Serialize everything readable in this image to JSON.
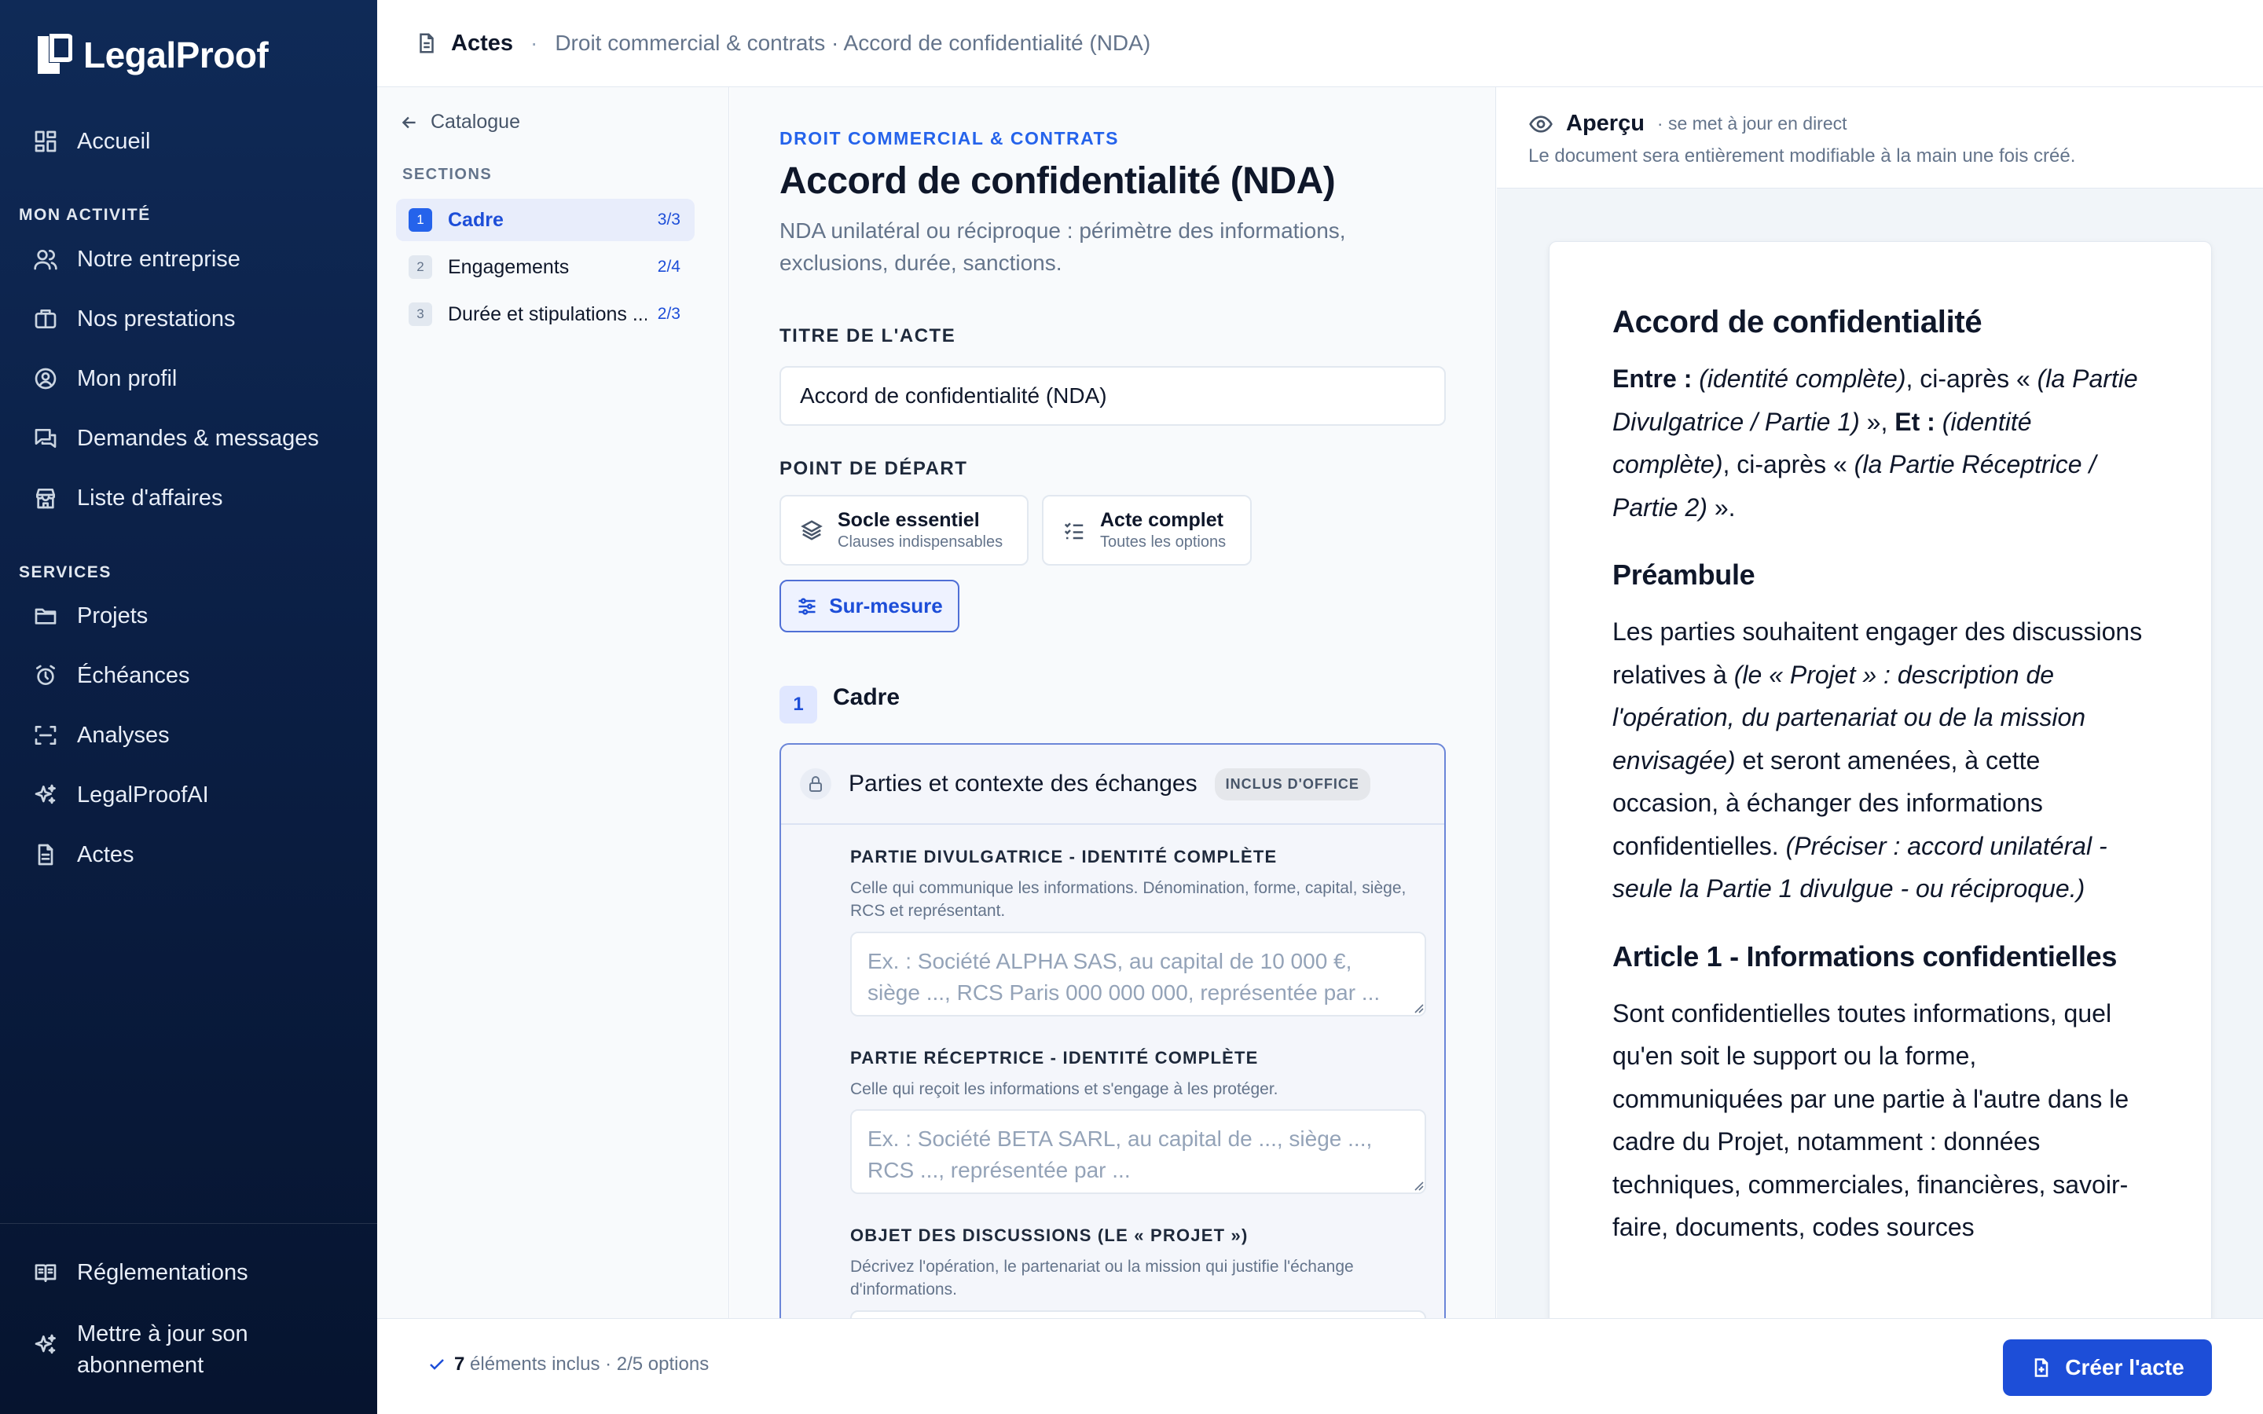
{
  "app": {
    "name": "LegalProof"
  },
  "sidebar": {
    "home": "Accueil",
    "activity_title": "MON ACTIVITÉ",
    "activity_items": [
      "Notre entreprise",
      "Nos prestations",
      "Mon profil",
      "Demandes & messages",
      "Liste d'affaires"
    ],
    "services_title": "SERVICES",
    "services_items": [
      "Projets",
      "Échéances",
      "Analyses",
      "LegalProofAI",
      "Actes"
    ],
    "bottom_items": [
      "Réglementations"
    ],
    "upgrade_line1": "Mettre à jour son",
    "upgrade_line2": "abonnement"
  },
  "breadcrumb": {
    "main": "Actes",
    "sep": "·",
    "rest": "Droit commercial & contrats · Accord de confidentialité (NDA)"
  },
  "sections_panel": {
    "back": "Catalogue",
    "title": "SECTIONS",
    "items": [
      {
        "num": "1",
        "label": "Cadre",
        "count": "3/3"
      },
      {
        "num": "2",
        "label": "Engagements",
        "count": "2/4"
      },
      {
        "num": "3",
        "label": "Durée et stipulations ...",
        "count": "2/3"
      }
    ]
  },
  "form": {
    "category": "DROIT COMMERCIAL & CONTRATS",
    "title": "Accord de confidentialité (NDA)",
    "subtitle": "NDA unilatéral ou réciproque : périmètre des informations, exclusions, durée, sanctions.",
    "title_label": "TITRE DE L'ACTE",
    "title_value": "Accord de confidentialité (NDA)",
    "start_label": "POINT DE DÉPART",
    "start_options": [
      {
        "title": "Socle essentiel",
        "sub": "Clauses indispensables"
      },
      {
        "title": "Acte complet",
        "sub": "Toutes les options"
      }
    ],
    "custom_label": "Sur-mesure",
    "step_num": "1",
    "step_title": "Cadre",
    "clause": {
      "title": "Parties et contexte des échanges",
      "badge": "INCLUS D'OFFICE",
      "fields": [
        {
          "label": "PARTIE DIVULGATRICE - IDENTITÉ COMPLÈTE",
          "help": "Celle qui communique les informations. Dénomination, forme, capital, siège, RCS et représentant.",
          "placeholder": "Ex. : Société ALPHA SAS, au capital de 10 000 €, siège ..., RCS Paris 000 000 000, représentée par ..."
        },
        {
          "label": "PARTIE RÉCEPTRICE - IDENTITÉ COMPLÈTE",
          "help": "Celle qui reçoit les informations et s'engage à les protéger.",
          "placeholder": "Ex. : Société BETA SARL, au capital de ..., siège ..., RCS ..., représentée par ..."
        },
        {
          "label": "OBJET DES DISCUSSIONS (LE « PROJET »)",
          "help": "Décrivez l'opération, le partenariat ou la mission qui justifie l'échange d'informations.",
          "placeholder": ""
        }
      ]
    }
  },
  "preview": {
    "title": "Aperçu",
    "live": "· se met à jour en direct",
    "note": "Le document sera entièrement modifiable à la main une fois créé.",
    "doc": {
      "h1": "Accord de confidentialité",
      "parties": {
        "entre": "Entre :",
        "p1": "(identité complète)",
        "t1": ", ci-après «",
        "p1_alias": "(la Partie Divulgatrice / Partie 1)",
        "t2": "»,",
        "et": "Et :",
        "p2": "(identité complète)",
        "t3": ", ci-après «",
        "p2_alias": "(la Partie Réceptrice / Partie 2)",
        "t4": "»."
      },
      "preamble_title": "Préambule",
      "preamble": {
        "a": "Les parties souhaitent engager des discussions relatives à",
        "b": "(le « Projet » : description de l'opération, du partenariat ou de la mission envisagée)",
        "c": "et seront amenées, à cette occasion, à échanger des informations confidentielles.",
        "d": "(Préciser : accord unilatéral - seule la Partie 1 divulgue - ou réciproque.)"
      },
      "article1_title": "Article 1 - Informations confidentielles",
      "article1": "Sont confidentielles toutes informations, quel qu'en soit le support ou la forme, communiquées par une partie à l'autre dans le cadre du Projet, notamment : données techniques, commerciales, financières, savoir-faire, documents, codes sources"
    }
  },
  "footer": {
    "count": "7",
    "status_rest": "éléments inclus · 2/5 options",
    "create": "Créer l'acte"
  }
}
